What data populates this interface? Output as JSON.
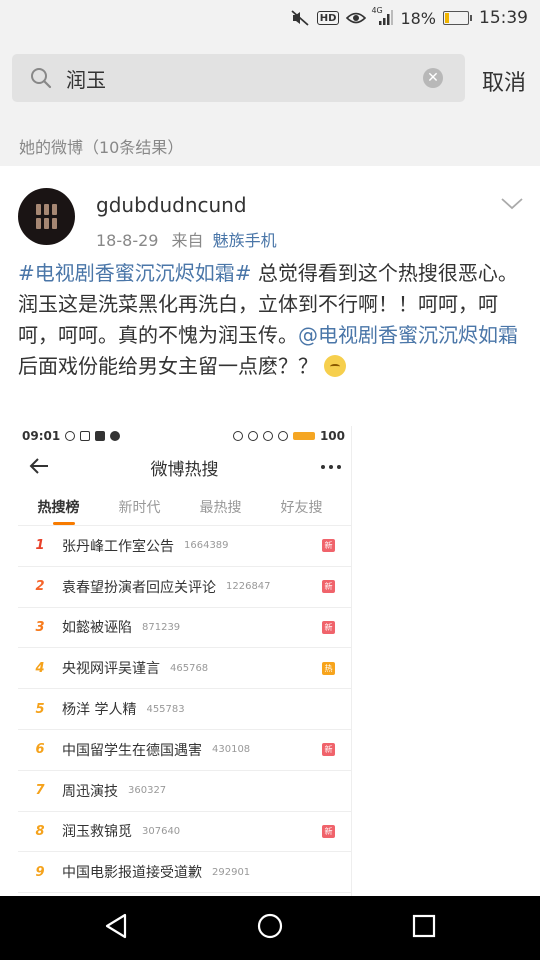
{
  "status_bar": {
    "signal_label": "4G",
    "battery_percent": "18%",
    "battery_level": 0.18,
    "time": "15:39",
    "hd_label": "HD",
    "icons": [
      "mute-icon",
      "hd-icon",
      "eye-icon",
      "signal-icon",
      "battery-icon"
    ]
  },
  "search": {
    "query": "润玉",
    "cancel_label": "取消"
  },
  "section": {
    "header": "她的微博（10条结果）"
  },
  "post": {
    "username": "gdubdudncund",
    "date": "18-8-29",
    "from_label": "来自",
    "source": "魅族手机",
    "hashtag": "#电视剧香蜜沉沉烬如霜#",
    "text_1": " 总觉得看到这个热搜很恶心。润玉这是洗菜黑化再洗白，立体到不行啊！！呵呵，呵呵，呵呵。真的不愧为润玉传。",
    "mention": "@电视剧香蜜沉沉烬如霜",
    "text_2": " 后面戏份能给男女主留一点麽？？",
    "emoji": "pursed-face-emoji"
  },
  "screenshot": {
    "time": "09:01",
    "battery": "100",
    "title": "微博热搜",
    "tabs": [
      "热搜榜",
      "新时代",
      "最热搜",
      "好友搜"
    ],
    "active_tab": 0,
    "badge_colors": {
      "新": "#f0636b",
      "热": "#f7a41c"
    },
    "trends": [
      {
        "rank": "1",
        "title": "张丹峰工作室公告",
        "count": "1664389",
        "badge": "新",
        "rank_color": "#e8412a"
      },
      {
        "rank": "2",
        "title": "袁春望扮演者回应关评论",
        "count": "1226847",
        "badge": "新",
        "rank_color": "#f5642a"
      },
      {
        "rank": "3",
        "title": "如懿被诬陷",
        "count": "871239",
        "badge": "新",
        "rank_color": "#f77b1d"
      },
      {
        "rank": "4",
        "title": "央视网评吴谨言",
        "count": "465768",
        "badge": "热",
        "rank_color": "#f5a21b"
      },
      {
        "rank": "5",
        "title": "杨洋 学人精",
        "count": "455783",
        "badge": "",
        "rank_color": "#f5a21b"
      },
      {
        "rank": "6",
        "title": "中国留学生在德国遇害",
        "count": "430108",
        "badge": "新",
        "rank_color": "#f5a21b"
      },
      {
        "rank": "7",
        "title": "周迅演技",
        "count": "360327",
        "badge": "",
        "rank_color": "#f5a21b"
      },
      {
        "rank": "8",
        "title": "润玉救锦觅",
        "count": "307640",
        "badge": "新",
        "rank_color": "#f5a21b"
      },
      {
        "rank": "9",
        "title": "中国电影报道接受道歉",
        "count": "292901",
        "badge": "",
        "rank_color": "#f5a21b"
      }
    ]
  },
  "nav": {
    "buttons": [
      "back-triangle-icon",
      "home-circle-icon",
      "recents-square-icon"
    ]
  }
}
